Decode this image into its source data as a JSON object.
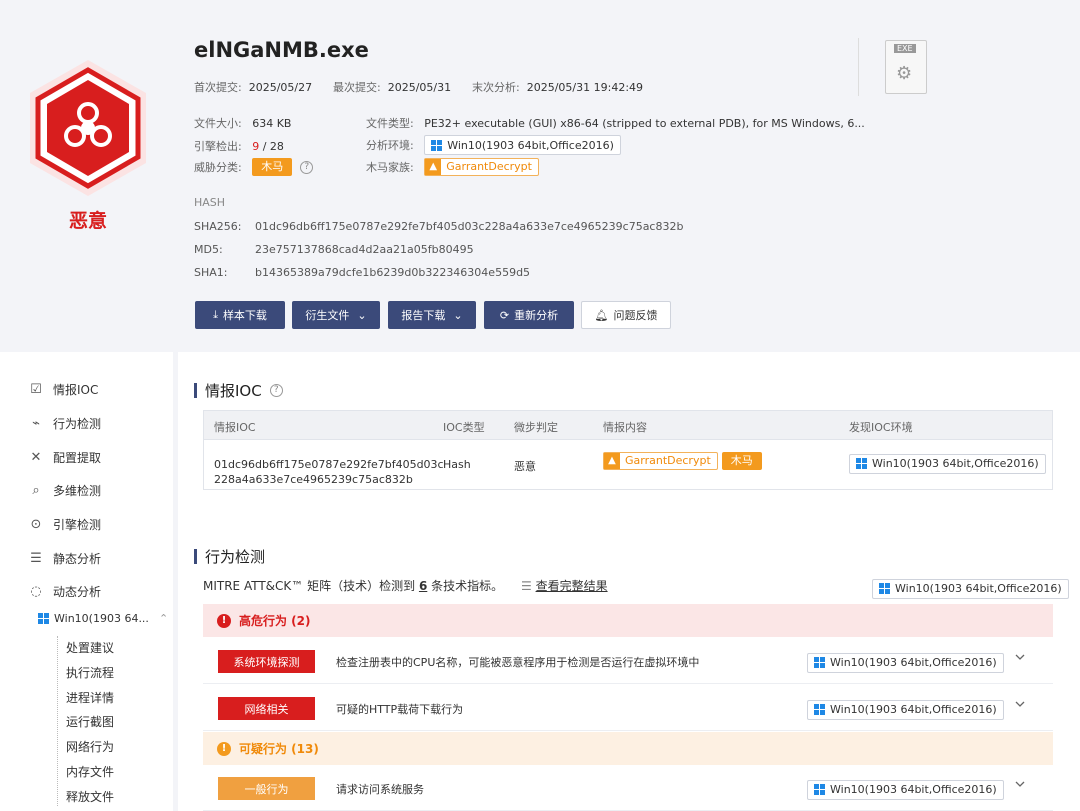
{
  "header": {
    "verdict": "恶意",
    "filename": "elNGaNMB.exe",
    "first_submit_label": "首次提交:",
    "first_submit": "2025/05/27",
    "last_submit_label": "最次提交:",
    "last_submit": "2025/05/31",
    "last_analysis_label": "末次分析:",
    "last_analysis": "2025/05/31 19:42:49",
    "file_size_label": "文件大小:",
    "file_size": "634 KB",
    "file_type_label": "文件类型:",
    "file_type": "PE32+ executable (GUI) x86-64 (stripped to external PDB), for MS Windows, 6...",
    "engine_label": "引擎检出:",
    "engine_hits": "9",
    "engine_total": "/ 28",
    "env_label": "分析环境:",
    "env": "Win10(1903 64bit,Office2016)",
    "threat_label": "威胁分类:",
    "threat": "木马",
    "family_label": "木马家族:",
    "family": "GarrantDecrypt",
    "hash_title": "HASH",
    "sha256_label": "SHA256:",
    "sha256": "01dc96db6ff175e0787e292fe7bf405d03c228a4a633e7ce4965239c75ac832b",
    "md5_label": "MD5:",
    "md5": "23e757137868cad4d2aa21a05fb80495",
    "sha1_label": "SHA1:",
    "sha1": "b14365389a79dcfe1b6239d0b322346304e559d5",
    "exe_icon_text": "EXE",
    "buttons": {
      "sample_download": "样本下载",
      "derived_files": "衍生文件",
      "report_download": "报告下载",
      "reanalyze": "重新分析",
      "feedback": "问题反馈"
    }
  },
  "sidebar": {
    "items": [
      {
        "label": "情报IOC",
        "icon": "intel-icon"
      },
      {
        "label": "行为检测",
        "icon": "behavior-icon"
      },
      {
        "label": "配置提取",
        "icon": "tools-icon"
      },
      {
        "label": "多维检测",
        "icon": "multi-detect-icon"
      },
      {
        "label": "引擎检测",
        "icon": "engine-icon"
      },
      {
        "label": "静态分析",
        "icon": "static-icon"
      },
      {
        "label": "动态分析",
        "icon": "dynamic-icon"
      }
    ],
    "env_node": "Win10(1903 64...",
    "sub_items": [
      "处置建议",
      "执行流程",
      "进程详情",
      "运行截图",
      "网络行为",
      "内存文件",
      "释放文件"
    ]
  },
  "ioc": {
    "title": "情报IOC",
    "columns": [
      "情报IOC",
      "IOC类型",
      "微步判定",
      "情报内容",
      "发现IOC环境"
    ],
    "row": {
      "ioc_line1": "01dc96db6ff175e0787e292fe7bf405d03c",
      "ioc_line2": "228a4a633e7ce4965239c75ac832b",
      "type": "Hash",
      "verdict": "恶意",
      "family": "GarrantDecrypt",
      "tag": "木马",
      "env": "Win10(1903 64bit,Office2016)"
    }
  },
  "behavior": {
    "title": "行为检测",
    "summary_prefix": "MITRE ATT&CK™ 矩阵（技术）检测到",
    "summary_count": "6",
    "summary_suffix": "条技术指标。",
    "view_all": "查看完整结果",
    "env": "Win10(1903 64bit,Office2016)",
    "high_title": "高危行为 (2)",
    "suspicious_title": "可疑行为 (13)",
    "rows": [
      {
        "tag": "系统环境探测",
        "desc": "检查注册表中的CPU名称，可能被恶意程序用于检测是否运行在虚拟环境中",
        "env": "Win10(1903 64bit,Office2016)"
      },
      {
        "tag": "网络相关",
        "desc": "可疑的HTTP载荷下载行为",
        "env": "Win10(1903 64bit,Office2016)"
      },
      {
        "tag": "一般行为",
        "desc": "请求访问系统服务",
        "env": "Win10(1903 64bit,Office2016)"
      }
    ]
  },
  "colors": {
    "danger": "#d81e1e",
    "warning": "#f39a1e",
    "primary": "#3b4a7a",
    "windows": "#1e88e5"
  }
}
